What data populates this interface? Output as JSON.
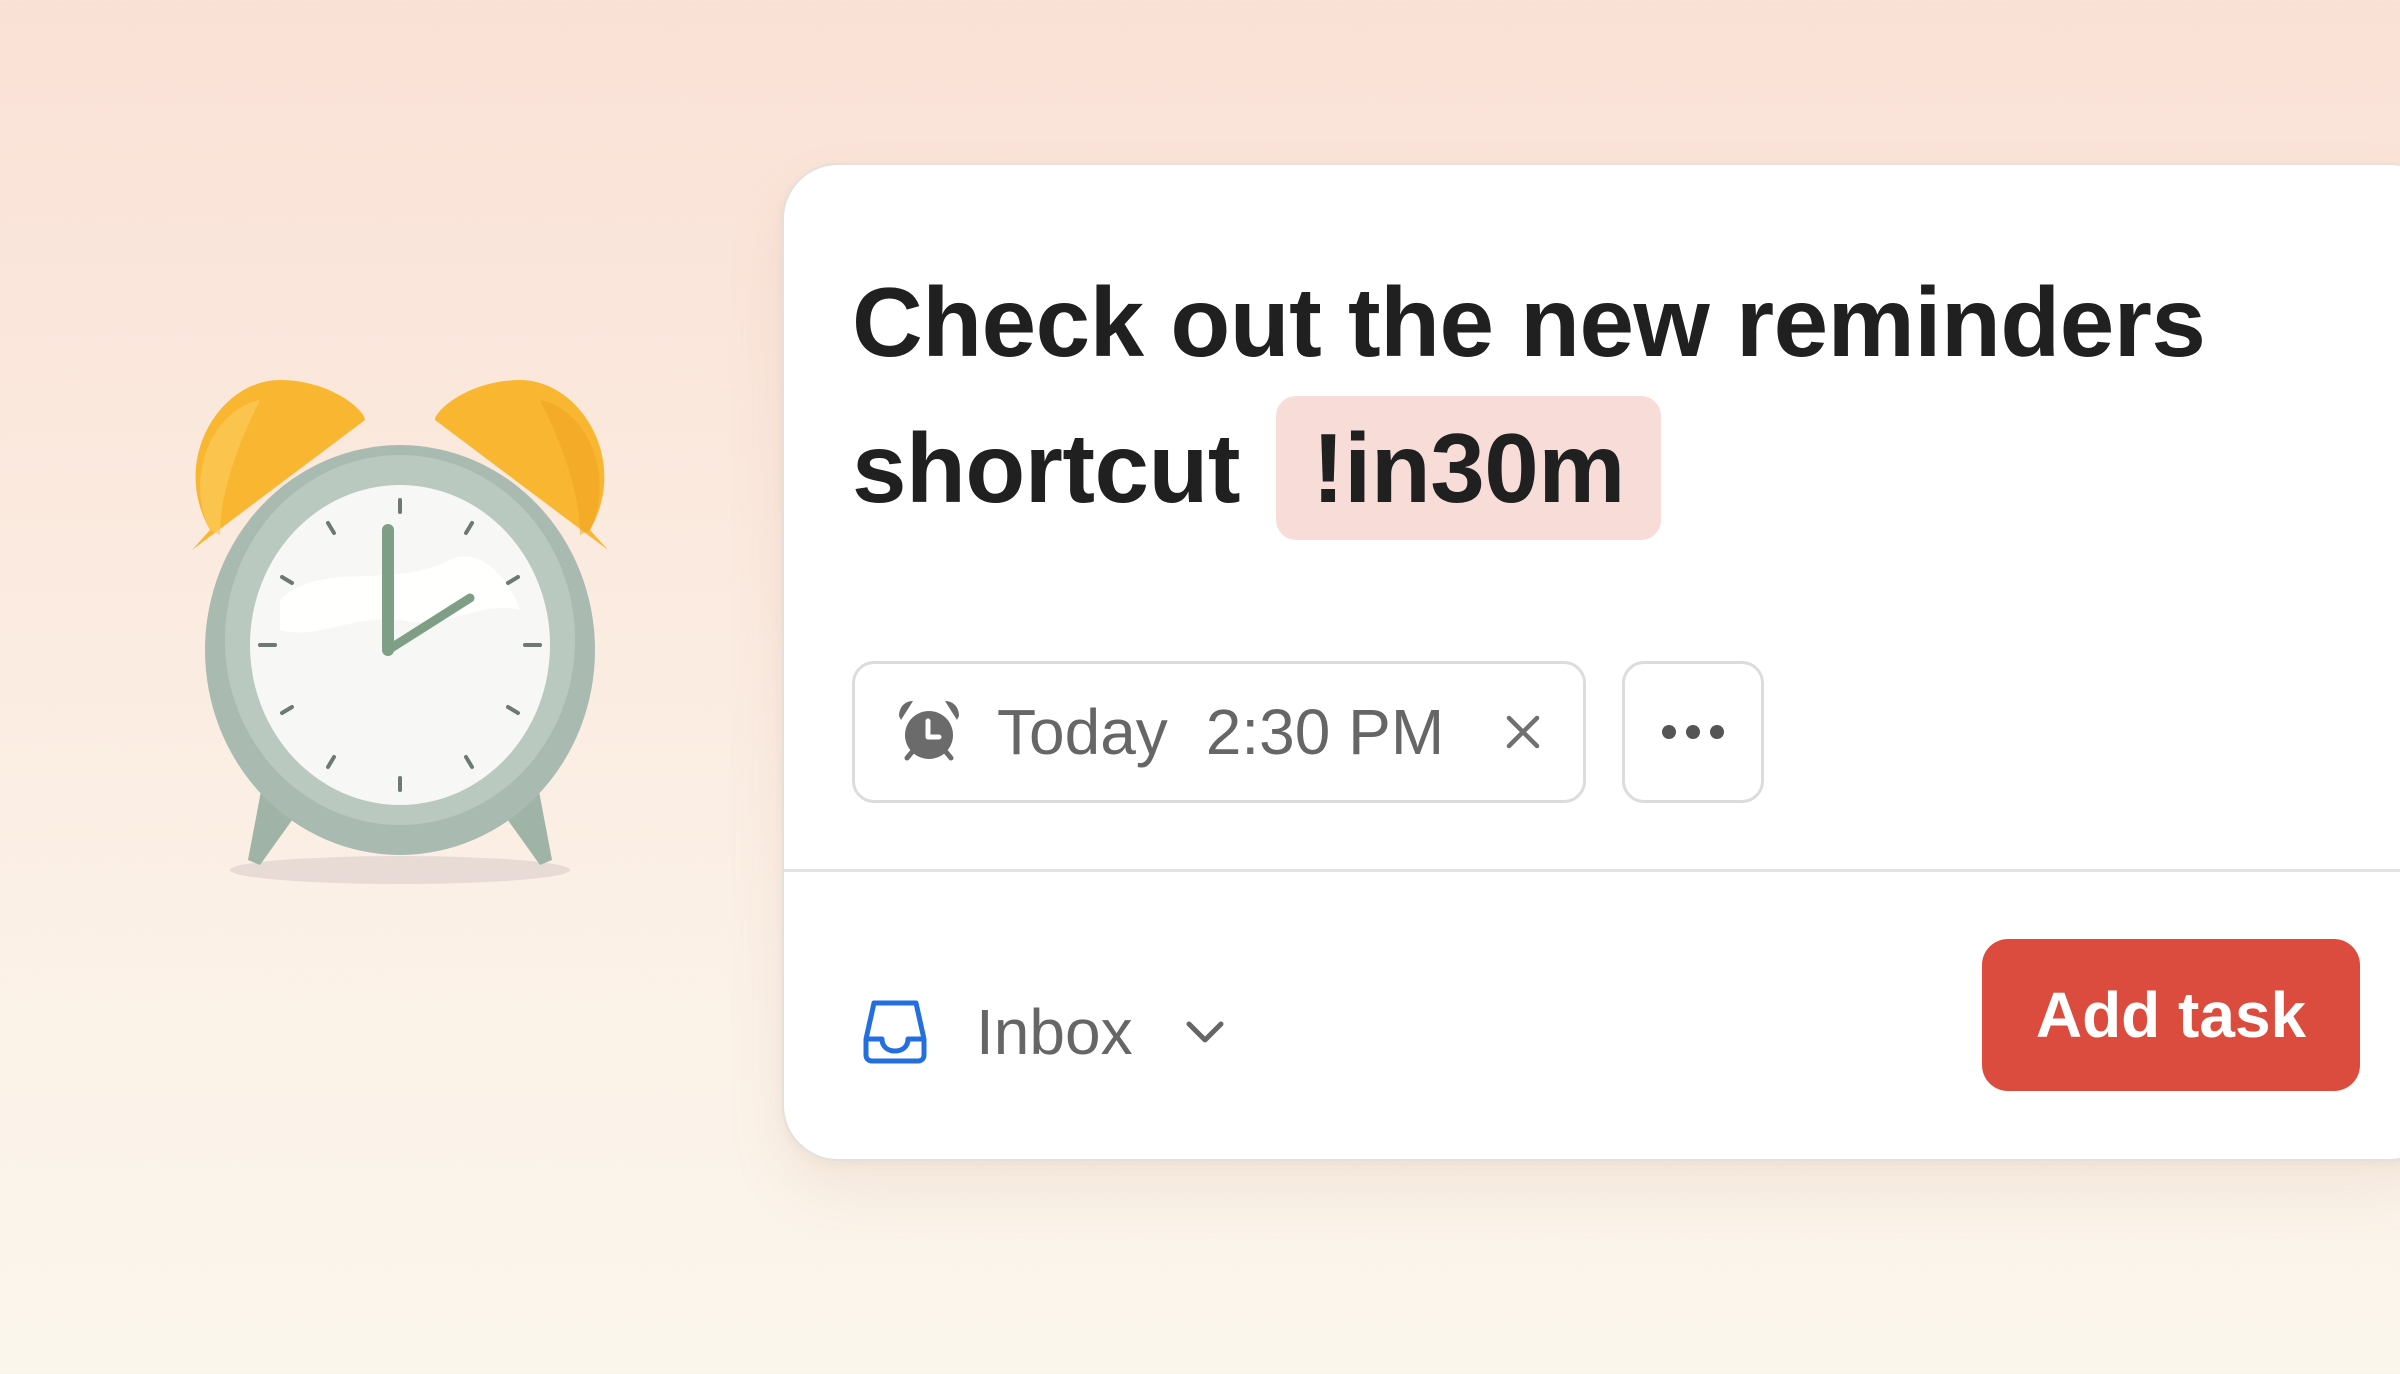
{
  "task": {
    "title_line1": "Check out the new reminders",
    "title_line2": "shortcut",
    "highlight": "!in30m"
  },
  "reminder": {
    "icon": "alarm-clock-icon",
    "day": "Today",
    "time": "2:30 PM",
    "clear_icon": "close-icon"
  },
  "more": {
    "icon": "more-horizontal-icon"
  },
  "project": {
    "icon": "inbox-icon",
    "label": "Inbox",
    "dropdown_icon": "chevron-down-icon"
  },
  "actions": {
    "add_task_label": "Add task"
  },
  "colors": {
    "accent": "#dc4c3e",
    "highlight_bg": "#f7dcd8",
    "inbox_icon": "#246fe0",
    "text": "#202020",
    "muted_text": "#666666"
  }
}
